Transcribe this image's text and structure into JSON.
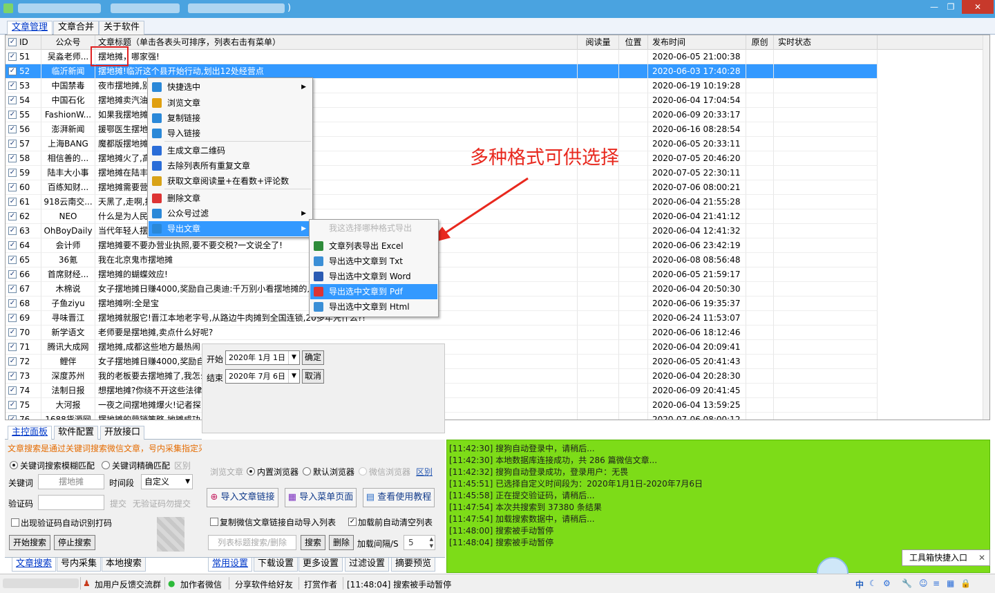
{
  "window": {
    "title_suffix": ")",
    "min": "—",
    "max": "❐",
    "close": "✕"
  },
  "top_tabs": [
    "文章管理",
    "文章合并",
    "关于软件"
  ],
  "columns": [
    "ID",
    "公众号",
    "文章标题（单击各表头可排序，列表右击有菜单）",
    "阅读量",
    "位置",
    "发布时间",
    "原创",
    "实时状态"
  ],
  "rows": [
    {
      "id": "51",
      "account": "吴淼老师...",
      "title": "摆地摊，哪家强!",
      "time": "2020-06-05 21:00:38"
    },
    {
      "id": "52",
      "account": "临沂新闻",
      "title": "摆地摊!临沂这个县开始行动,划出12处经营点",
      "time": "2020-06-03 17:40:28"
    },
    {
      "id": "53",
      "account": "中国禁毒",
      "title": "夜市摆地摊,别",
      "time": "2020-06-19 10:19:28"
    },
    {
      "id": "54",
      "account": "中国石化",
      "title": "摆地摊卖汽油",
      "time": "2020-06-04 17:04:54"
    },
    {
      "id": "55",
      "account": "FashionW...",
      "title": "如果我摆地摊",
      "time": "2020-06-09 20:33:17"
    },
    {
      "id": "56",
      "account": "澎湃新闻",
      "title": "援鄂医生摆地",
      "time": "2020-06-16 08:28:54"
    },
    {
      "id": "57",
      "account": "上海BANG",
      "title": "魔都版摆地摊",
      "time": "2020-06-05 20:33:11"
    },
    {
      "id": "58",
      "account": "相信善的...",
      "title": "摆地摊火了,高",
      "time": "2020-07-05 20:46:20"
    },
    {
      "id": "59",
      "account": "陆丰大小事",
      "title": "摆地摊在陆丰",
      "time": "2020-07-05 22:30:11"
    },
    {
      "id": "60",
      "account": "百练知财...",
      "title": "摆地摊需要营",
      "time": "2020-07-06 08:00:21"
    },
    {
      "id": "61",
      "account": "918云南交...",
      "title": "天黑了,走啊,摆",
      "time": "2020-06-04 21:55:28"
    },
    {
      "id": "62",
      "account": "NEO",
      "title": "什么是为人民",
      "time": "2020-06-04 21:41:12"
    },
    {
      "id": "63",
      "account": "OhBoyDaily",
      "title": "当代年轻人摆",
      "time": "2020-06-04 12:41:32"
    },
    {
      "id": "64",
      "account": "会计师",
      "title": "摆地摊要不要办营业执照,要不要交税?一文说全了!",
      "time": "2020-06-06 23:42:19"
    },
    {
      "id": "65",
      "account": "36氪",
      "title": "我在北京鬼市摆地摊",
      "time": "2020-06-08 08:56:48"
    },
    {
      "id": "66",
      "account": "首席财经...",
      "title": "摆地摊的蝴蝶效应!",
      "time": "2020-06-05 21:59:17"
    },
    {
      "id": "67",
      "account": "木棉说",
      "title": "女子摆地摊日赚4000,奖励自己奥迪:千万别小看摆地摊的人",
      "time": "2020-06-04 20:50:30"
    },
    {
      "id": "68",
      "account": "子鱼ziyu",
      "title": "摆地摊咧:全是宝",
      "time": "2020-06-06 19:35:37"
    },
    {
      "id": "69",
      "account": "寻味晋江",
      "title": "摆地摊就服它!晋江本地老字号,从路边牛肉摊到全国连锁,20多年凭什么?!",
      "time": "2020-06-24 11:53:07"
    },
    {
      "id": "70",
      "account": "新学语文",
      "title": "老师要是摆地摊,卖点什么好呢?",
      "time": "2020-06-06 18:12:46"
    },
    {
      "id": "71",
      "account": "腾讯大成网",
      "title": "摆地摊,成都这些地方最热闹",
      "time": "2020-06-04 20:09:41"
    },
    {
      "id": "72",
      "account": "鲤伴",
      "title": "女子摆地摊日赚4000,奖励自",
      "time": "2020-06-05 20:41:43"
    },
    {
      "id": "73",
      "account": "深度苏州",
      "title": "我的老板要去摆地摊了,我怎么",
      "time": "2020-06-04 20:28:30"
    },
    {
      "id": "74",
      "account": "法制日报",
      "title": "想摆地摊?你绕不开这些法律",
      "time": "2020-06-09 20:41:45"
    },
    {
      "id": "75",
      "account": "大河报",
      "title": "一夜之间摆地摊爆火!记者探",
      "time": "2020-06-04 13:59:25"
    },
    {
      "id": "76",
      "account": "1688货源网",
      "title": "摆地摊的营销策略,地摊成功",
      "time": "2020-07-06 08:00:12"
    }
  ],
  "context_menu": [
    {
      "label": "快捷选中",
      "icon": "lightning-icon",
      "sub": true
    },
    {
      "label": "浏览文章",
      "icon": "chrome-icon",
      "sub": false
    },
    {
      "label": "复制链接",
      "icon": "copy-doc-icon",
      "sub": false
    },
    {
      "label": "导入链接",
      "icon": "import-icon",
      "sub": false
    },
    {
      "label": "生成文章二维码",
      "icon": "qrcode-icon",
      "sub": false
    },
    {
      "label": "去除列表所有重复文章",
      "icon": "dedupe-icon",
      "sub": false
    },
    {
      "label": "获取文章阅读量+在看数+评论数",
      "icon": "chart-icon",
      "sub": false
    },
    {
      "label": "删除文章",
      "icon": "trash-icon",
      "sub": false
    },
    {
      "label": "公众号过滤",
      "icon": "filter-icon",
      "sub": true
    },
    {
      "label": "导出文章",
      "icon": "export-icon",
      "sub": true
    }
  ],
  "submenu": {
    "hint": "我这选择哪种格式导出",
    "items": [
      {
        "label": "文章列表导出 Excel",
        "icon": "excel-icon",
        "color": "#2e8b3a"
      },
      {
        "label": "导出选中文章到 Txt",
        "icon": "txt-icon",
        "color": "#3b8fd6"
      },
      {
        "label": "导出选中文章到 Word",
        "icon": "word-icon",
        "color": "#2b5bb3"
      },
      {
        "label": "导出选中文章到 Pdf",
        "icon": "pdf-icon",
        "color": "#d33"
      },
      {
        "label": "导出选中文章到 Html",
        "icon": "html-icon",
        "color": "#3b8fd6"
      }
    ]
  },
  "annotation": "多种格式可供选择",
  "date_panel": {
    "start_label": "开始",
    "start_value": "2020年 1月 1日",
    "end_label": "结束",
    "end_value": "2020年 7月 6日",
    "ok": "确定",
    "cancel": "取消"
  },
  "left_tabs_top": [
    "主控面板",
    "软件配置",
    "开放接口"
  ],
  "left_panel": {
    "hint": "文章搜索是通过关键词搜索微信文章，号内采集指定采集某个公众号的",
    "radio_fuzzy": "关键词搜索模糊匹配",
    "radio_exact": "关键词精确匹配",
    "diff": "区别",
    "keyword_label": "关键词",
    "keyword_value": "摆地摊",
    "time_label": "时间段",
    "time_value": "自定义",
    "captcha_label": "验证码",
    "submit": "提交",
    "no_captcha": "无验证码勿提交",
    "auto_captcha": "出现验证码自动识别打码",
    "start": "开始搜索",
    "stop": "停止搜索"
  },
  "left_tabs_bottom": [
    "文章搜索",
    "号内采集",
    "本地搜索"
  ],
  "mid_panel": {
    "browse_label": "浏览文章",
    "builtin": "内置浏览器",
    "default": "默认浏览器",
    "wechat": "微信浏览器",
    "diff": "区别",
    "import_link": "导入文章链接",
    "import_menu": "导入菜单页面",
    "tutorial": "查看使用教程",
    "auto_import": "复制微信文章链接自动导入列表",
    "clear_before": "加载前自动清空列表",
    "search_placeholder": "列表标题搜索/删除",
    "search": "搜索",
    "delete": "删除",
    "interval_label": "加载间隔/S",
    "interval_value": "5"
  },
  "mid_tabs_bottom": [
    "常用设置",
    "下载设置",
    "更多设置",
    "过滤设置",
    "摘要预览"
  ],
  "log": [
    "[11:42:30] 搜狗自动登录中，请稍后...",
    "[11:42:30] 本地数据库连接成功，共 286 篇微信文章...",
    "[11:42:32] 搜狗自动登录成功，登录用户：无畏",
    "[11:45:51] 已选择自定义时间段为：2020年1月1日-2020年7月6日",
    "[11:45:58] 正在提交验证码，请稍后...",
    "[11:47:54] 本次共搜索到 37380 条结果",
    "[11:47:54] 加载搜索数据中，请稍后...",
    "[11:48:00] 搜索被手动暂停",
    "[11:48:04] 搜索被手动暂停"
  ],
  "status": {
    "feedback": "加用户反馈交流群",
    "author_wechat": "加作者微信",
    "share": "分享软件给好友",
    "tip": "打赏作者",
    "last": "[11:48:04] 搜索被手动暂停",
    "toolbox": "工具箱快捷入口",
    "ime": "中"
  }
}
